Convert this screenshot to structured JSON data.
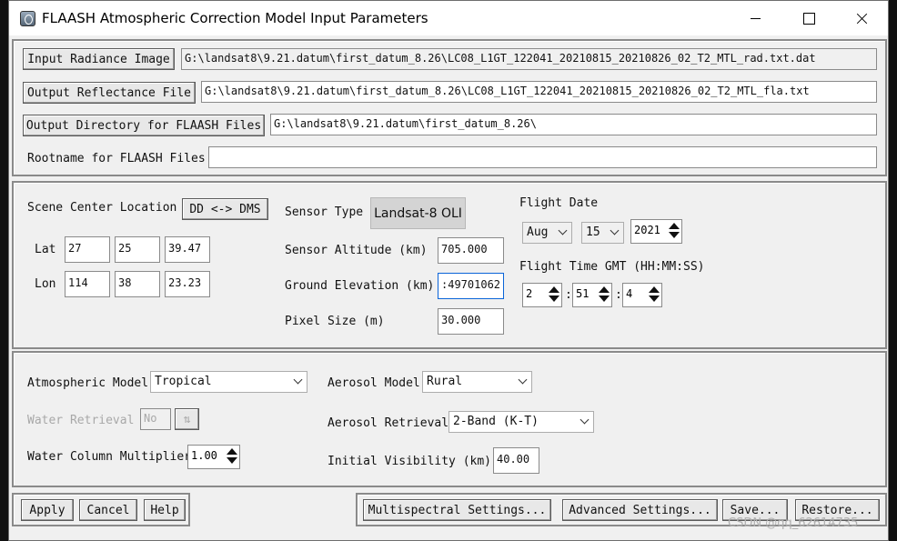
{
  "window": {
    "title": "FLAASH Atmospheric Correction Model Input Parameters"
  },
  "files": {
    "input_radiance_label": "Input Radiance Image",
    "input_radiance_value": "G:\\landsat8\\9.21.datum\\first_datum_8.26\\LC08_L1GT_122041_20210815_20210826_02_T2_MTL_rad.txt.dat",
    "output_reflectance_label": "Output Reflectance File",
    "output_reflectance_value": "G:\\landsat8\\9.21.datum\\first_datum_8.26\\LC08_L1GT_122041_20210815_20210826_02_T2_MTL_fla.txt",
    "output_directory_label": "Output Directory for FLAASH Files",
    "output_directory_value": "G:\\landsat8\\9.21.datum\\first_datum_8.26\\",
    "rootname_label": "Rootname for FLAASH Files",
    "rootname_value": ""
  },
  "scene": {
    "location_label": "Scene Center Location",
    "dd_dms_label": "DD <-> DMS",
    "lat_label": "Lat",
    "lat": [
      "27",
      "25",
      "39.47"
    ],
    "lon_label": "Lon",
    "lon": [
      "114",
      "38",
      "23.23"
    ],
    "sensor_type_label": "Sensor Type",
    "sensor_type_value": "Landsat-8 OLI",
    "sensor_altitude_label": "Sensor Altitude (km)",
    "sensor_altitude_value": "705.000",
    "ground_elevation_label": "Ground Elevation (km)",
    "ground_elevation_value": ":49701062",
    "pixel_size_label": "Pixel Size (m)",
    "pixel_size_value": "30.000",
    "flight_date_label": "Flight Date",
    "flight_month": "Aug",
    "flight_day": "15",
    "flight_year": "2021",
    "flight_time_label": "Flight Time GMT (HH:MM:SS)",
    "flight_hh": "2",
    "flight_mm": "51",
    "flight_ss": "4",
    "time_sep": ":"
  },
  "atmosphere": {
    "model_label": "Atmospheric Model",
    "model_value": "Tropical",
    "water_retrieval_label": "Water Retrieval",
    "water_retrieval_value": "No",
    "water_column_label": "Water Column Multiplier",
    "water_column_value": "1.00",
    "aerosol_model_label": "Aerosol Model",
    "aerosol_model_value": "Rural",
    "aerosol_retrieval_label": "Aerosol Retrieval",
    "aerosol_retrieval_value": "2-Band (K-T)",
    "visibility_label": "Initial Visibility (km)",
    "visibility_value": "40.00"
  },
  "footer": {
    "apply": "Apply",
    "cancel": "Cancel",
    "help": "Help",
    "multispectral": "Multispectral Settings...",
    "advanced": "Advanced Settings...",
    "save": "Save...",
    "restore": "Restore..."
  },
  "watermark": "CSDN @qq_62614735"
}
